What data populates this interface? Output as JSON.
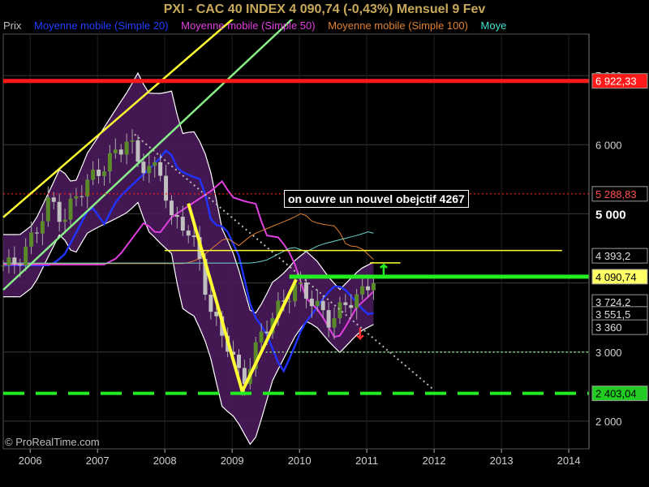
{
  "header": {
    "title": "PXI - CAC 40 INDEX     4 090,74 (-0,43%)     Mensuel  9 Fev"
  },
  "legend": [
    {
      "label": "Prix",
      "color": "#c0c0c0"
    },
    {
      "label": "Moyenne mobile (Simple 20)",
      "color": "#1f3fff"
    },
    {
      "label": "Moyenne mobile (Simple 50)",
      "color": "#e040e0"
    },
    {
      "label": "Moyenne mobile (Simple 100)",
      "color": "#e08030"
    },
    {
      "label": "Moye",
      "color": "#40e0d0"
    }
  ],
  "watermark": "© ProRealTime.com",
  "annotation": "on ouvre un nouvel obejctif 4267",
  "colors": {
    "background": "#000000",
    "plot_background": "#000000",
    "grid": "#3a3a3a",
    "bollinger_fill": "#4a1a5a",
    "bollinger_edge": "#ffffff",
    "candle_up": "#5a8a2a",
    "candle_down": "#c0c0c0",
    "resistance_red": "#ff1a1a",
    "support_green": "#22ee22",
    "channel_yellow": "#ffff33",
    "channel_green": "#88ee88"
  },
  "chart_data": {
    "type": "line",
    "title": "PXI - CAC 40 INDEX     4 090,74 (-0,43%)     Mensuel  9 Fev",
    "xlabel": "",
    "ylabel": "",
    "xlim": [
      2005.6,
      2014.3
    ],
    "ylim": [
      1600,
      7600
    ],
    "x_ticks": [
      2006,
      2007,
      2008,
      2009,
      2010,
      2011,
      2012,
      2013,
      2014
    ],
    "y_ticks": [
      {
        "value": 2000,
        "label": "2 000"
      },
      {
        "value": 3000,
        "label": "3 000"
      },
      {
        "value": 6000,
        "label": "6 000"
      },
      {
        "value": 7000,
        "label": "7 000"
      }
    ],
    "grid": true,
    "price_series": [
      {
        "x": 2005.7,
        "y": 4250
      },
      {
        "x": 2005.9,
        "y": 4400
      },
      {
        "x": 2006.1,
        "y": 4800
      },
      {
        "x": 2006.3,
        "y": 5200
      },
      {
        "x": 2006.5,
        "y": 4900
      },
      {
        "x": 2006.7,
        "y": 5300
      },
      {
        "x": 2006.9,
        "y": 5500
      },
      {
        "x": 2007.1,
        "y": 5700
      },
      {
        "x": 2007.3,
        "y": 5900
      },
      {
        "x": 2007.45,
        "y": 6100
      },
      {
        "x": 2007.6,
        "y": 5750
      },
      {
        "x": 2007.8,
        "y": 5650
      },
      {
        "x": 2007.95,
        "y": 5600
      },
      {
        "x": 2008.1,
        "y": 4900
      },
      {
        "x": 2008.3,
        "y": 4850
      },
      {
        "x": 2008.5,
        "y": 4400
      },
      {
        "x": 2008.7,
        "y": 3500
      },
      {
        "x": 2008.9,
        "y": 3200
      },
      {
        "x": 2009.15,
        "y": 2550
      },
      {
        "x": 2009.3,
        "y": 2900
      },
      {
        "x": 2009.45,
        "y": 3300
      },
      {
        "x": 2009.6,
        "y": 3500
      },
      {
        "x": 2009.8,
        "y": 3800
      },
      {
        "x": 2009.95,
        "y": 3950
      },
      {
        "x": 2010.1,
        "y": 3850
      },
      {
        "x": 2010.3,
        "y": 3600
      },
      {
        "x": 2010.45,
        "y": 3450
      },
      {
        "x": 2010.6,
        "y": 3600
      },
      {
        "x": 2010.75,
        "y": 3750
      },
      {
        "x": 2010.95,
        "y": 3850
      },
      {
        "x": 2011.1,
        "y": 4090
      }
    ],
    "levels": [
      {
        "name": "resistance",
        "value": 6922.33,
        "label": "6 922,33",
        "style": "solid-red"
      },
      {
        "name": "dotted-red",
        "value": 5288.83,
        "label": "5 288,83",
        "style": "dotted-red"
      },
      {
        "name": "major",
        "value": 5000,
        "label": "5 000",
        "style": "tick-bold"
      },
      {
        "name": "ma100",
        "value": 4393.2,
        "label": "4 393,2",
        "style": "tag-dark"
      },
      {
        "name": "last",
        "value": 4090.74,
        "label": "4 090,74",
        "style": "solid-green"
      },
      {
        "name": "ma20",
        "value": 3724.2,
        "label": "3 724,2",
        "style": "tag-dark"
      },
      {
        "name": "ma50",
        "value": 3551.5,
        "label": "3 551,5",
        "style": "tag-dark"
      },
      {
        "name": "low-tag",
        "value": 3360,
        "label": "3 360",
        "style": "tag-dark"
      },
      {
        "name": "dotted-green",
        "value": 3000,
        "label": "",
        "style": "dotted-green"
      },
      {
        "name": "support",
        "value": 2403.04,
        "label": "2 403,04",
        "style": "dashed-green"
      }
    ]
  }
}
